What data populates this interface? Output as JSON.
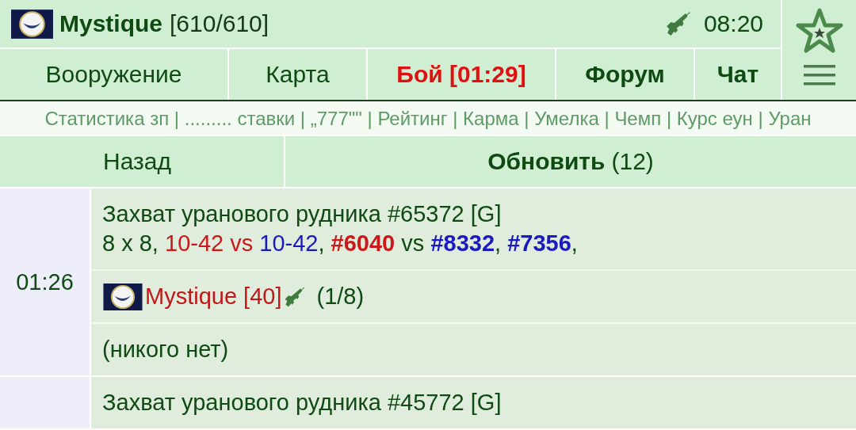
{
  "header": {
    "name": "Mystique",
    "hp": "[610/610]",
    "time": "08:20"
  },
  "tabs": [
    {
      "label": "Вооружение",
      "kind": "normal"
    },
    {
      "label": "Карта",
      "kind": "normal"
    },
    {
      "label": "Бой [01:29]",
      "kind": "alert"
    },
    {
      "label": "Форум",
      "kind": "bold"
    },
    {
      "label": "Чат",
      "kind": "bold"
    }
  ],
  "links": [
    "Статистика зп",
    "......... ставки",
    "„777\"\"",
    "Рейтинг",
    "Карма",
    "Умелка",
    "Чемп",
    "Курс еун",
    "Уран"
  ],
  "link_separator": "|",
  "actions": {
    "back": "Назад",
    "refresh": "Обновить",
    "count": "(12)"
  },
  "battles": [
    {
      "time": "01:26",
      "title": "Захват уранового рудника #65372 [G]",
      "details": [
        {
          "text": "8 x 8, ",
          "bold": false
        },
        {
          "text": "10-42 vs",
          "color": "#cc1818",
          "bold": false
        },
        {
          "text": " 10-42",
          "color": "#1a1ac0",
          "bold": false
        },
        {
          "text": ", ",
          "bold": false
        },
        {
          "text": "#6040",
          "color": "#cc1818",
          "bold": true
        },
        {
          "text": " vs ",
          "bold": false
        },
        {
          "text": "#8332",
          "color": "#1a1ac0",
          "bold": true
        },
        {
          "text": ", ",
          "bold": false
        },
        {
          "text": "#7356",
          "color": "#1a1ac0",
          "bold": true
        },
        {
          "text": ",",
          "bold": false
        }
      ],
      "teams": [
        {
          "kind": "player",
          "name": "Mystique",
          "level": "[40]",
          "count": "(1/8)"
        },
        {
          "kind": "empty",
          "text": "(никого нет)"
        }
      ]
    },
    {
      "title": "Захват уранового рудника #45772 [G]"
    }
  ]
}
